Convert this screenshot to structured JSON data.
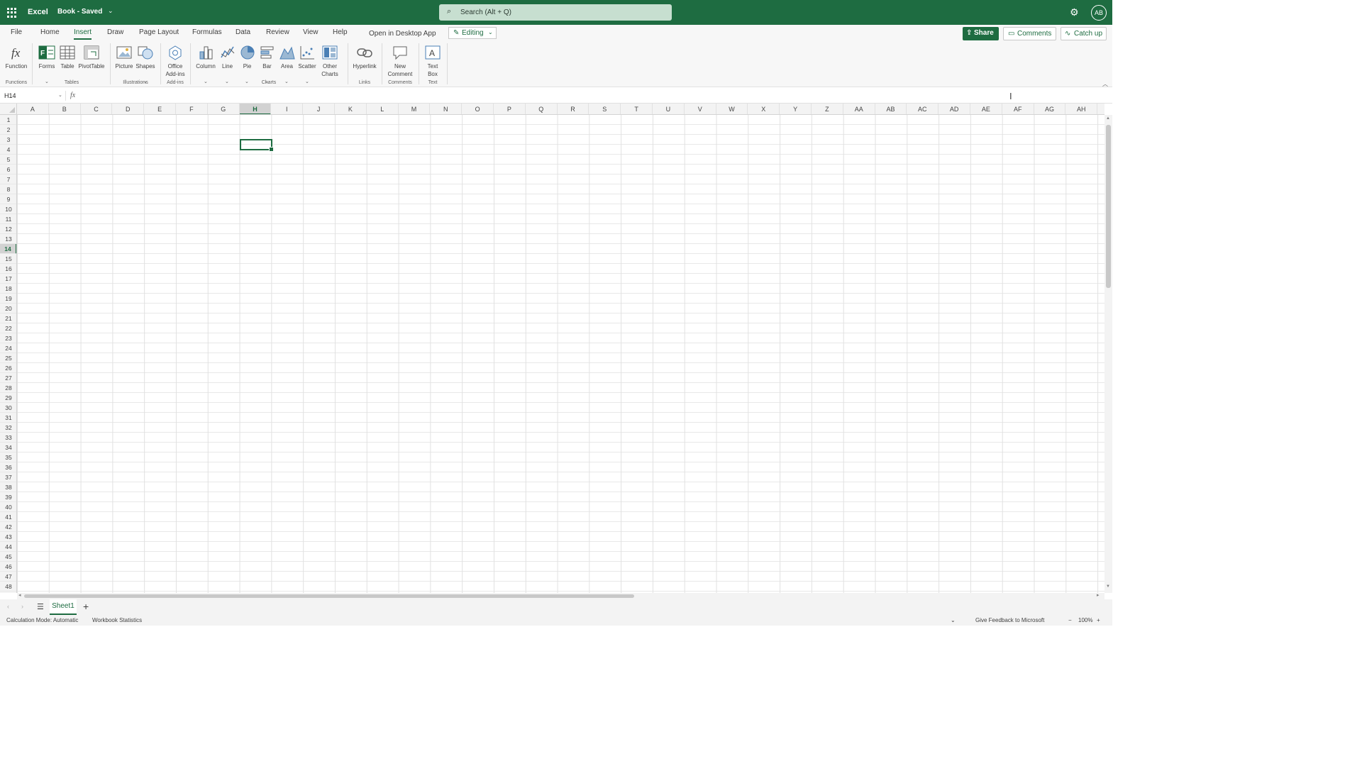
{
  "titlebar": {
    "app_name": "Excel",
    "doc_title": "Book - Saved",
    "search_placeholder": "Search (Alt + Q)",
    "avatar_initials": "AB"
  },
  "menu": {
    "tabs": [
      "File",
      "Home",
      "Insert",
      "Draw",
      "Page Layout",
      "Formulas",
      "Data",
      "Review",
      "View",
      "Help",
      "Open in Desktop App"
    ],
    "active_tab": "Insert",
    "editing_label": "Editing",
    "share_label": "Share",
    "comments_label": "Comments",
    "catchup_label": "Catch up"
  },
  "ribbon": {
    "buttons": [
      {
        "label": "Function",
        "icon": "function-icon"
      },
      {
        "label": "Forms",
        "icon": "forms-icon"
      },
      {
        "label": "Table",
        "icon": "table-icon"
      },
      {
        "label": "PivotTable",
        "icon": "pivottable-icon"
      },
      {
        "label": "Picture",
        "icon": "picture-icon"
      },
      {
        "label": "Shapes",
        "icon": "shapes-icon"
      },
      {
        "label": "Office Add-ins",
        "icon": "office-addins-icon"
      },
      {
        "label": "Column",
        "icon": "column-chart-icon"
      },
      {
        "label": "Line",
        "icon": "line-chart-icon"
      },
      {
        "label": "Pie",
        "icon": "pie-chart-icon"
      },
      {
        "label": "Bar",
        "icon": "bar-chart-icon"
      },
      {
        "label": "Area",
        "icon": "area-chart-icon"
      },
      {
        "label": "Scatter",
        "icon": "scatter-chart-icon"
      },
      {
        "label": "Other Charts",
        "icon": "other-charts-icon"
      },
      {
        "label": "Hyperlink",
        "icon": "hyperlink-icon"
      },
      {
        "label": "New Comment",
        "icon": "new-comment-icon"
      },
      {
        "label": "Text Box",
        "icon": "text-box-icon"
      }
    ],
    "groups": [
      "Functions",
      "Tables",
      "Illustrations",
      "Add-ins",
      "Charts",
      "Links",
      "Comments",
      "Text"
    ]
  },
  "formula_bar": {
    "name_box": "H14",
    "fx": "fx",
    "value": ""
  },
  "grid": {
    "columns": [
      "A",
      "B",
      "C",
      "D",
      "E",
      "F",
      "G",
      "H",
      "I",
      "J",
      "K",
      "L",
      "M",
      "N",
      "O",
      "P",
      "Q",
      "R",
      "S",
      "T",
      "U",
      "V",
      "W",
      "X",
      "Y",
      "Z",
      "AA",
      "AB",
      "AC",
      "AD",
      "AE",
      "AF",
      "AG",
      "AH"
    ],
    "rows": [
      "1",
      "2",
      "3",
      "4",
      "5",
      "6",
      "7",
      "8",
      "9",
      "10",
      "11",
      "12",
      "13",
      "14",
      "15",
      "16",
      "17",
      "18",
      "19",
      "20",
      "21",
      "22",
      "23",
      "24",
      "25",
      "26",
      "27",
      "28",
      "29",
      "30",
      "31",
      "32",
      "33",
      "34",
      "35",
      "36",
      "37",
      "38",
      "39",
      "40",
      "41",
      "42",
      "43",
      "44",
      "45",
      "46",
      "47",
      "48"
    ],
    "selected_column": "H",
    "selected_row": "14"
  },
  "sheets": {
    "tabs": [
      "Sheet1"
    ],
    "add_label": "+"
  },
  "statusbar": {
    "calc_mode": "Calculation Mode: Automatic",
    "workbook_stats": "Workbook Statistics",
    "feedback": "Give Feedback to Microsoft",
    "zoom": "100%"
  },
  "colors": {
    "brand": "#1e6c41",
    "header_bg": "#f3f3f3",
    "gridline": "#e1e1e1"
  }
}
